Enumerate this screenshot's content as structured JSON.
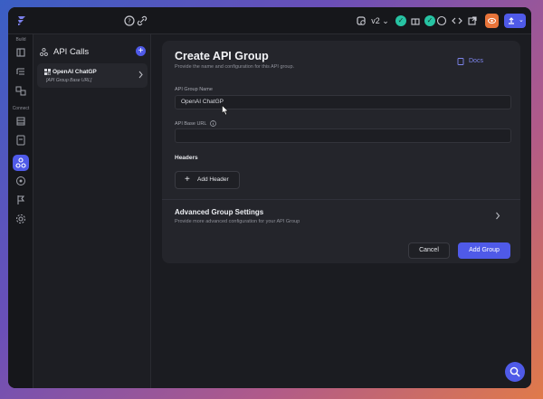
{
  "topbar": {
    "version": "v2",
    "colors": {
      "accent": "#4f5ae8",
      "teal": "#27c3a3",
      "orange": "#e8743a"
    },
    "icons": [
      "help-icon",
      "link-icon",
      "cloud-icon",
      "version-dropdown",
      "check-badge",
      "gift-icon",
      "check-badge",
      "chat-icon",
      "code-icon",
      "open-external-icon",
      "preview-icon",
      "publish-icon"
    ]
  },
  "rail": {
    "build_label": "Build",
    "connect_label": "Connect"
  },
  "panel": {
    "title": "API Calls",
    "items": [
      {
        "name": "OpenAI ChatGP",
        "sub": "[API Group Base URL]"
      }
    ]
  },
  "card": {
    "title": "Create API Group",
    "subtitle": "Provide the name and configuration for this API group.",
    "docs_label": "Docs",
    "group_name_label": "API Group Name",
    "group_name_value": "OpenAI ChatGP",
    "base_url_label": "API Base URL",
    "base_url_value": "",
    "headers_label": "Headers",
    "add_header_label": "Add Header",
    "advanced_title": "Advanced Group Settings",
    "advanced_sub": "Provide more advanced configuration for your API Group",
    "cancel_label": "Cancel",
    "add_group_label": "Add Group"
  }
}
